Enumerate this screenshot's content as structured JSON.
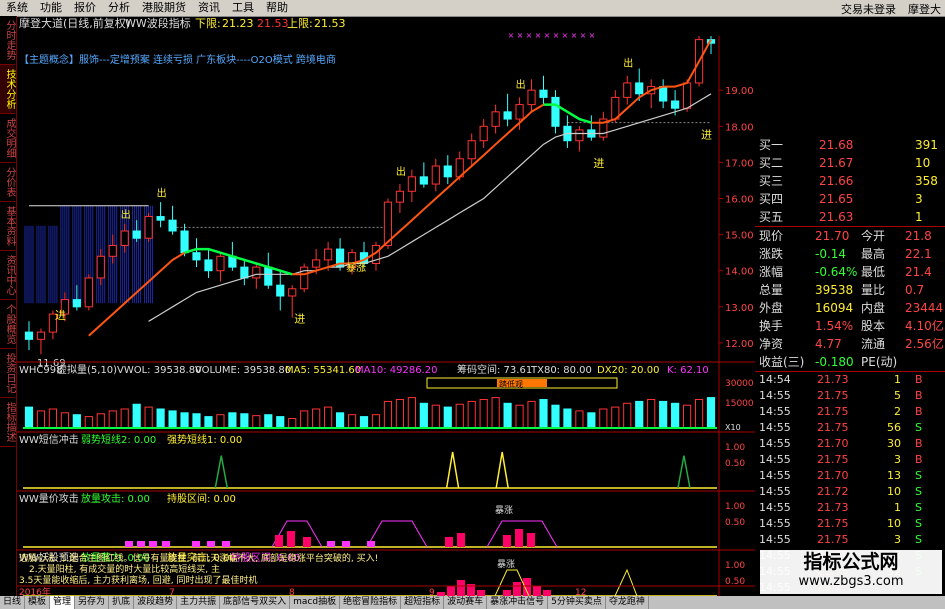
{
  "menu": {
    "items": [
      "系统",
      "功能",
      "报价",
      "分析",
      "港股期货",
      "资讯",
      "工具",
      "帮助"
    ],
    "right_items": [
      "交易未登录",
      "摩登大"
    ]
  },
  "left_tabs": [
    {
      "label": "分时走势",
      "active": false
    },
    {
      "label": "技术分析",
      "active": true
    },
    {
      "label": "成交明细",
      "active": false
    },
    {
      "label": "分价表",
      "active": false
    },
    {
      "label": "基本资料",
      "active": false
    },
    {
      "label": "资讯中心",
      "active": false
    },
    {
      "label": "个股概览",
      "active": false
    },
    {
      "label": "投资日记",
      "active": false
    },
    {
      "label": "指标描述",
      "active": false
    }
  ],
  "header": {
    "title": "摩登大道(日线,前复权)",
    "indicator": "WW波段指标",
    "lower_label": "下限:",
    "lower_value": "21.23",
    "mid_value": "21.53",
    "upper_label": "上限:",
    "upper_value": "21.53",
    "concepts": "【主题概念】服饰---定增预案 连续亏损 广东板块----O2O模式 跨境电商"
  },
  "colors": {
    "up": "#ff3333",
    "down": "#33ffff",
    "ma_red": "#ff5511",
    "ma_white": "#cccccc",
    "ma_green": "#00ff44",
    "yellow": "#ffee33",
    "green_text": "#33ff33",
    "pink": "#ff33ff"
  },
  "price_axis": {
    "ticks": [
      "19.00",
      "18.00",
      "17.00",
      "16.00",
      "15.00",
      "14.00",
      "13.00",
      "12.00"
    ]
  },
  "annotations": {
    "low_price": "11.69",
    "jin": "进",
    "chu": "出",
    "baozhang": "暴涨"
  },
  "volume_header": {
    "name": "WHC998",
    "name2": "虚拟量(5,10)",
    "vol": "VWOL: 39538.80",
    "volume": "VOLUME: 39538.80",
    "ma5": "MA5: 55341.60",
    "ma10": "MA10: 49286.20",
    "chip": "筹码空间: 73.61",
    "tx80": "TX80: 80.00",
    "dx20": "DX20: 20.00",
    "k": "K: 62.10",
    "axis_top": "30000",
    "axis_mid": "15000",
    "axis_unit": "X10",
    "badge": "踏低观"
  },
  "panel1": {
    "name": "WW短信冲击",
    "l1": "弱势短线2: 0.00",
    "l2": "强势短线1: 0.00",
    "ticks": [
      "1.00",
      "0.50"
    ]
  },
  "panel2": {
    "name": "WW量价攻击",
    "l1": "放量攻击: 0.00",
    "l2": "持股区间: 0.00",
    "label": "暴涨",
    "ticks": [
      "1.00",
      "0.50"
    ]
  },
  "panel3": {
    "name": "WW妖股预选",
    "l1": "放量蓄力: 0.00",
    "l2": "放量突击: 0.00",
    "l3": "持股区间: 0.00",
    "label": "暴涨",
    "ticks": [
      "1.00",
      "0.50"
    ]
  },
  "footer_notes": {
    "line1": "选股心法: 1.配合主图红线。信号有量能柱, 前几天涨幅不大, 底部是稳涨平台突破的, 买入!",
    "line2": "2.天量阳柱, 有成交量的时大量比较高短线买, 主",
    "line3": "3.5天量能收缩后, 主力获利离场, 回避, 同时出现了最佳时机"
  },
  "date_axis": {
    "labels": [
      "2016年",
      "7",
      "8",
      "9",
      "12"
    ]
  },
  "quote": {
    "bids": [
      {
        "label": "买一",
        "price": "21.68",
        "vol": "391"
      },
      {
        "label": "买二",
        "price": "21.67",
        "vol": "10"
      },
      {
        "label": "买三",
        "price": "21.66",
        "vol": "358"
      },
      {
        "label": "买四",
        "price": "21.65",
        "vol": "3"
      },
      {
        "label": "买五",
        "price": "21.63",
        "vol": "1"
      }
    ],
    "stats": [
      {
        "l": "现价",
        "v": "21.70",
        "l2": "今开",
        "v2": "21.8"
      },
      {
        "l": "涨跌",
        "v": "-0.14",
        "l2": "最高",
        "v2": "22.1"
      },
      {
        "l": "涨幅",
        "v": "-0.64%",
        "l2": "最低",
        "v2": "21.4"
      },
      {
        "l": "总量",
        "v": "39538",
        "l2": "量比",
        "v2": "0.7"
      },
      {
        "l": "外盘",
        "v": "16094",
        "l2": "内盘",
        "v2": "23444"
      },
      {
        "l": "换手",
        "v": "1.54%",
        "l2": "股本",
        "v2": "4.10亿"
      },
      {
        "l": "净资",
        "v": "4.77",
        "l2": "流通",
        "v2": "2.56亿"
      },
      {
        "l": "收益(三)",
        "v": "-0.180",
        "l2": "PE(动)",
        "v2": ""
      }
    ]
  },
  "ticks_list": [
    {
      "t": "14:54",
      "p": "21.73",
      "v": "1",
      "d": "B"
    },
    {
      "t": "14:55",
      "p": "21.75",
      "v": "5",
      "d": "B"
    },
    {
      "t": "14:55",
      "p": "21.75",
      "v": "2",
      "d": "B"
    },
    {
      "t": "14:55",
      "p": "21.75",
      "v": "56",
      "d": "S"
    },
    {
      "t": "14:55",
      "p": "21.70",
      "v": "30",
      "d": "B"
    },
    {
      "t": "14:55",
      "p": "21.75",
      "v": "3",
      "d": "B"
    },
    {
      "t": "14:55",
      "p": "21.70",
      "v": "13",
      "d": "S"
    },
    {
      "t": "14:55",
      "p": "21.72",
      "v": "10",
      "d": "S"
    },
    {
      "t": "14:55",
      "p": "21.73",
      "v": "1",
      "d": "S"
    },
    {
      "t": "14:55",
      "p": "21.75",
      "v": "10",
      "d": "S"
    },
    {
      "t": "14:55",
      "p": "21.75",
      "v": "3",
      "d": "S"
    },
    {
      "t": "14:55",
      "p": "21.75",
      "v": "5",
      "d": "S"
    },
    {
      "t": "14:55",
      "p": "21.75",
      "v": "32",
      "d": "S"
    },
    {
      "t": "14:55",
      "p": "21.7",
      "v": "",
      "d": ""
    }
  ],
  "bottom_tabs": [
    "日线",
    "模板",
    "管理",
    "另存为",
    "扒底",
    "波段趋势",
    "主力共振",
    "底部信号双买入",
    "macd抽板",
    "绝密冒险指标",
    "超短指标",
    "波动赛车",
    "暴涨冲击信号",
    "5分钟买卖点",
    "夺龙跑神"
  ],
  "bottom_active": 2,
  "watermark": {
    "title": "指标公式网",
    "url": "www.zbgs3.com"
  },
  "chart_data": {
    "type": "candlestick",
    "title": "摩登大道(日线,前复权)",
    "ylim": [
      11.5,
      20.5
    ],
    "ohlc": [
      [
        12.3,
        12.6,
        11.8,
        12.1
      ],
      [
        12.1,
        12.4,
        11.69,
        12.3
      ],
      [
        12.3,
        12.9,
        12.1,
        12.8
      ],
      [
        12.8,
        13.4,
        12.6,
        13.2
      ],
      [
        13.2,
        13.6,
        12.9,
        13.0
      ],
      [
        13.0,
        13.9,
        12.9,
        13.8
      ],
      [
        13.8,
        14.6,
        13.6,
        14.4
      ],
      [
        14.4,
        15.0,
        14.2,
        14.7
      ],
      [
        14.7,
        15.3,
        14.5,
        15.1
      ],
      [
        15.1,
        15.4,
        14.8,
        14.9
      ],
      [
        14.9,
        15.6,
        14.8,
        15.5
      ],
      [
        15.5,
        15.9,
        15.2,
        15.4
      ],
      [
        15.4,
        15.8,
        15.0,
        15.1
      ],
      [
        15.1,
        15.3,
        14.4,
        14.5
      ],
      [
        14.5,
        14.9,
        14.1,
        14.3
      ],
      [
        14.3,
        14.6,
        13.8,
        14.0
      ],
      [
        14.0,
        14.5,
        13.7,
        14.4
      ],
      [
        14.4,
        14.8,
        14.0,
        14.1
      ],
      [
        14.1,
        14.3,
        13.6,
        13.8
      ],
      [
        13.8,
        14.2,
        13.5,
        14.1
      ],
      [
        14.1,
        14.5,
        13.5,
        13.6
      ],
      [
        13.6,
        14.0,
        12.9,
        13.3
      ],
      [
        13.3,
        13.6,
        12.7,
        13.5
      ],
      [
        13.5,
        14.2,
        13.4,
        14.1
      ],
      [
        14.1,
        14.6,
        13.9,
        14.3
      ],
      [
        14.3,
        14.8,
        14.0,
        14.6
      ],
      [
        14.6,
        14.9,
        14.0,
        14.1
      ],
      [
        14.1,
        14.6,
        13.9,
        14.5
      ],
      [
        14.5,
        14.8,
        14.1,
        14.2
      ],
      [
        14.2,
        14.8,
        14.0,
        14.7
      ],
      [
        14.7,
        16.0,
        14.6,
        15.9
      ],
      [
        15.9,
        16.4,
        15.6,
        16.2
      ],
      [
        16.2,
        16.8,
        15.9,
        16.6
      ],
      [
        16.6,
        17.0,
        16.3,
        16.4
      ],
      [
        16.4,
        17.1,
        16.2,
        16.9
      ],
      [
        16.9,
        17.2,
        16.4,
        16.6
      ],
      [
        16.6,
        17.3,
        16.5,
        17.1
      ],
      [
        17.1,
        17.8,
        16.9,
        17.6
      ],
      [
        17.6,
        18.2,
        17.4,
        18.0
      ],
      [
        18.0,
        18.6,
        17.8,
        18.4
      ],
      [
        18.4,
        18.9,
        18.0,
        18.2
      ],
      [
        18.2,
        18.8,
        17.9,
        18.6
      ],
      [
        18.6,
        19.3,
        18.4,
        19.0
      ],
      [
        19.0,
        19.4,
        18.6,
        18.8
      ],
      [
        18.8,
        19.0,
        17.8,
        18.0
      ],
      [
        18.0,
        18.3,
        17.4,
        17.6
      ],
      [
        17.6,
        18.0,
        17.3,
        17.9
      ],
      [
        17.9,
        18.3,
        17.6,
        17.7
      ],
      [
        17.7,
        18.4,
        17.6,
        18.2
      ],
      [
        18.2,
        19.0,
        18.1,
        18.8
      ],
      [
        18.8,
        19.4,
        18.6,
        19.2
      ],
      [
        19.2,
        19.6,
        18.7,
        18.9
      ],
      [
        18.9,
        19.3,
        18.5,
        19.1
      ],
      [
        19.1,
        19.3,
        18.5,
        18.7
      ],
      [
        18.7,
        19.0,
        18.3,
        18.5
      ],
      [
        18.5,
        19.3,
        18.4,
        19.2
      ],
      [
        19.2,
        20.5,
        19.1,
        20.4
      ],
      [
        20.4,
        20.5,
        20.0,
        20.3
      ]
    ],
    "ma_red": [
      null,
      null,
      null,
      null,
      null,
      12.2,
      12.5,
      12.8,
      13.1,
      13.4,
      13.7,
      14.0,
      14.3,
      14.5,
      14.6,
      14.6,
      14.5,
      14.4,
      14.3,
      14.2,
      14.1,
      14.0,
      13.9,
      13.9,
      14.0,
      14.1,
      14.2,
      14.2,
      14.3,
      14.5,
      14.8,
      15.1,
      15.4,
      15.7,
      16.0,
      16.3,
      16.6,
      16.9,
      17.2,
      17.5,
      17.8,
      18.1,
      18.4,
      18.6,
      18.6,
      18.4,
      18.2,
      18.1,
      18.1,
      18.2,
      18.5,
      18.8,
      19.0,
      19.1,
      19.1,
      19.2,
      19.8,
      20.4
    ],
    "ma_white": [
      null,
      null,
      null,
      null,
      null,
      null,
      null,
      null,
      null,
      null,
      12.6,
      12.8,
      13.0,
      13.2,
      13.4,
      13.5,
      13.6,
      13.7,
      13.8,
      13.9,
      13.9,
      13.9,
      13.9,
      14.0,
      14.0,
      14.1,
      14.1,
      14.2,
      14.2,
      14.3,
      14.4,
      14.6,
      14.8,
      15.0,
      15.2,
      15.4,
      15.6,
      15.8,
      16.0,
      16.3,
      16.6,
      16.9,
      17.2,
      17.5,
      17.7,
      17.8,
      17.8,
      17.8,
      17.8,
      17.9,
      18.0,
      18.1,
      18.2,
      18.3,
      18.4,
      18.5,
      18.7,
      18.9
    ],
    "cloud_band": {
      "upper": 15.8,
      "lower": 13.1,
      "start": 0,
      "end": 10
    },
    "volume": [
      22,
      18,
      20,
      16,
      14,
      12,
      15,
      18,
      20,
      25,
      22,
      20,
      18,
      16,
      15,
      12,
      14,
      16,
      15,
      13,
      14,
      12,
      10,
      18,
      20,
      22,
      16,
      14,
      12,
      14,
      28,
      30,
      32,
      26,
      24,
      22,
      25,
      28,
      30,
      32,
      26,
      24,
      28,
      30,
      24,
      20,
      18,
      16,
      20,
      22,
      26,
      28,
      30,
      28,
      26,
      24,
      30,
      32
    ],
    "panel1_spikes": [
      [
        24,
        0.9
      ],
      [
        52,
        1.0
      ],
      [
        58,
        1.0
      ],
      [
        80,
        0.9
      ]
    ]
  }
}
